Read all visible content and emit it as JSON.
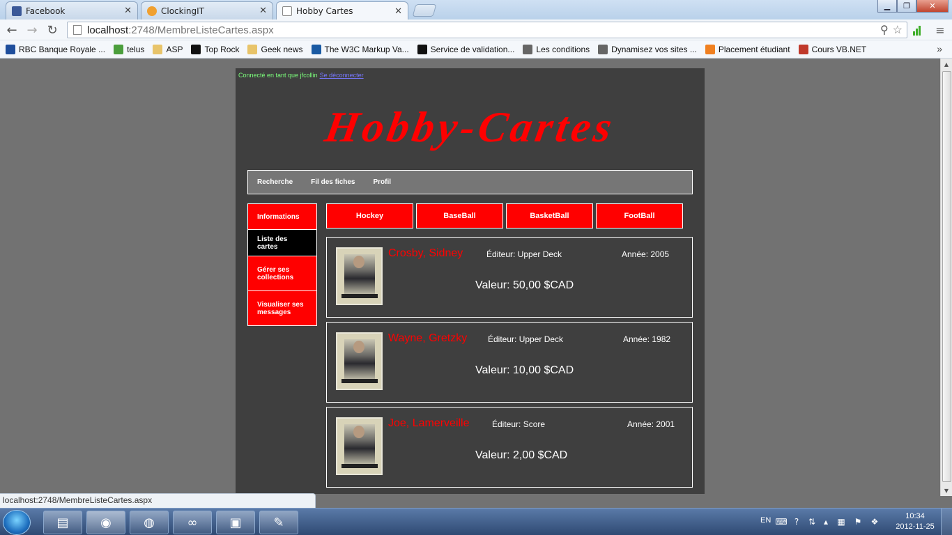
{
  "browser": {
    "tabs": [
      {
        "title": "Facebook",
        "color": "#3b5998"
      },
      {
        "title": "ClockingIT",
        "color": "#f0a030"
      },
      {
        "title": "Hobby Cartes",
        "color": "#ffffff"
      }
    ],
    "url_host": "localhost",
    "url_path": ":2748/MembreListeCartes.aspx",
    "bookmarks": [
      {
        "label": "RBC Banque Royale ...",
        "color": "#1f4e9c"
      },
      {
        "label": "telus",
        "color": "#4b9e3c"
      },
      {
        "label": "ASP",
        "color": "#e8c46a"
      },
      {
        "label": "Top Rock",
        "color": "#111111"
      },
      {
        "label": "Geek news",
        "color": "#e8c46a"
      },
      {
        "label": "The W3C Markup Va...",
        "color": "#1a5aa3"
      },
      {
        "label": "Service de validation...",
        "color": "#111111"
      },
      {
        "label": "Les conditions",
        "color": "#666666"
      },
      {
        "label": "Dynamisez vos sites ...",
        "color": "#666666"
      },
      {
        "label": "Placement étudiant",
        "color": "#f08020"
      },
      {
        "label": "Cours VB.NET",
        "color": "#c0392b"
      }
    ],
    "status_url": "localhost:2748/MembreListeCartes.aspx"
  },
  "site": {
    "login_text": "Connecté en tant que jfcollin",
    "logout_link": "Se déconnecter",
    "logo": "Hobby-Cartes",
    "topnav": [
      "Recherche",
      "Fil des fiches",
      "Profil"
    ],
    "sidenav": [
      {
        "label": "Informations",
        "active": false
      },
      {
        "label": "Liste des cartes",
        "active": true
      },
      {
        "label": "Gérer ses collections",
        "active": false
      },
      {
        "label": "Visualiser ses messages",
        "active": false
      }
    ],
    "sports": [
      "Hockey",
      "BaseBall",
      "BasketBall",
      "FootBall"
    ],
    "cards": [
      {
        "name": "Crosby, Sidney",
        "editeur": "Éditeur: Upper Deck",
        "annee": "Année: 2005",
        "valeur": "Valeur: 50,00 $CAD"
      },
      {
        "name": "Wayne, Gretzky",
        "editeur": "Éditeur: Upper Deck",
        "annee": "Année: 1982",
        "valeur": "Valeur: 10,00 $CAD"
      },
      {
        "name": "Joe, Lamerveille",
        "editeur": "Éditeur: Score",
        "annee": "Année: 2001",
        "valeur": "Valeur: 2,00 $CAD"
      }
    ],
    "accent_color": "#ff0000"
  },
  "taskbar": {
    "language": "EN",
    "time": "10:34",
    "date": "2012-11-25"
  }
}
